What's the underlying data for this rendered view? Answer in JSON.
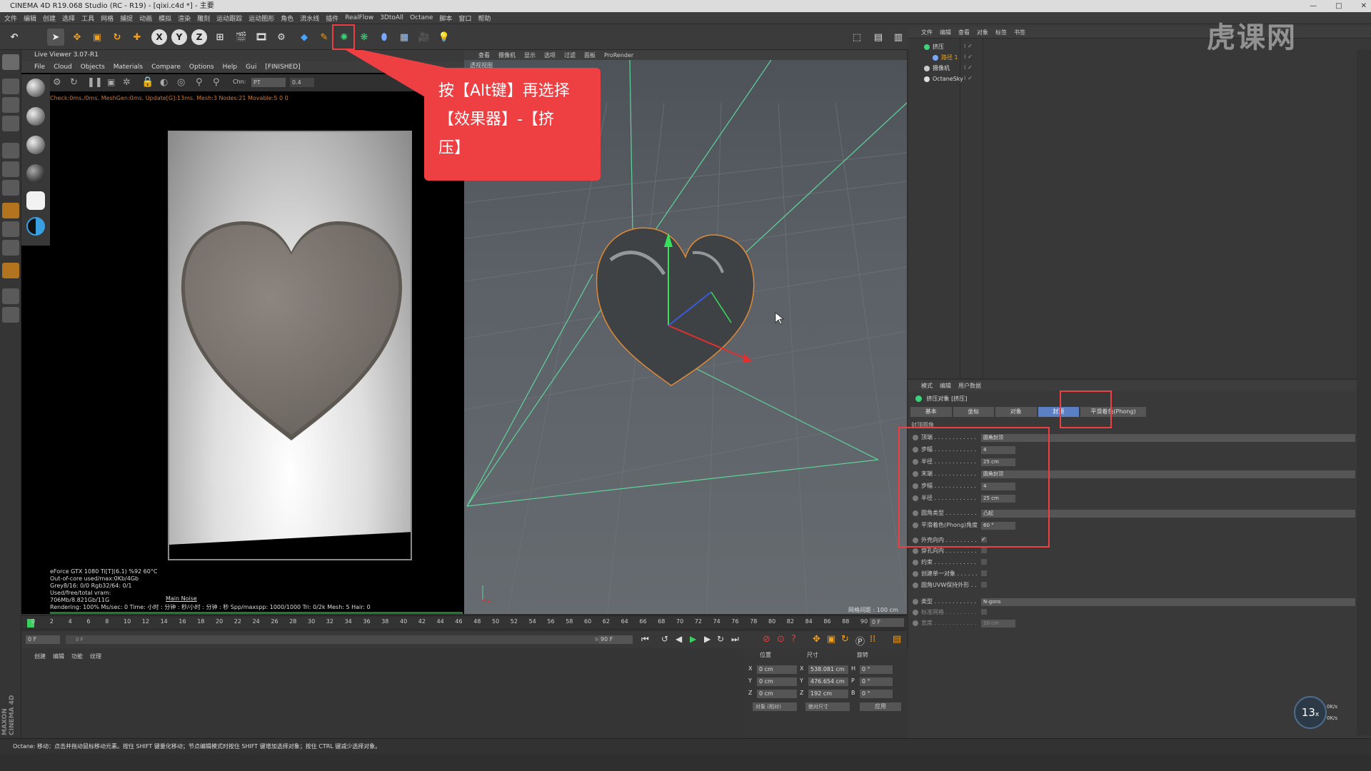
{
  "window": {
    "title": "CINEMA 4D R19.068 Studio (RC - R19) - [qixi.c4d *] - 主要",
    "controls": [
      "—",
      "□",
      "✕"
    ]
  },
  "menubar": [
    "文件",
    "编辑",
    "创建",
    "选择",
    "工具",
    "网格",
    "捕捉",
    "动画",
    "模拟",
    "渲染",
    "雕刻",
    "运动跟踪",
    "运动图形",
    "角色",
    "流水线",
    "插件",
    "RealFlow",
    "3DtoAll",
    "Octane",
    "脚本",
    "窗口",
    "帮助"
  ],
  "toolbar": {
    "axes": [
      "X",
      "Y",
      "Z"
    ],
    "undo_icon": "undo-icon"
  },
  "live_viewer": {
    "title": "Live Viewer 3.07-R1",
    "menu": [
      "File",
      "Cloud",
      "Objects",
      "Materials",
      "Compare",
      "Options",
      "Help",
      "Gui",
      "[FINISHED]"
    ],
    "chn_label": "Chn:",
    "chn_value": "PT",
    "zoom_value": "0.4",
    "status": "Check:0ms./0ms. MeshGen:0ms. Update[G]:13ms. Mesh:3 Nodes:21 Movable:5  0 0",
    "gpu_info": [
      "eForce GTX 1080 Ti[T](6.1)  %92     60°C",
      "Out-of-core used/max:0Kb/4Gb",
      "Grey8/16: 0/0          Rgb32/64: 0/1",
      "Used/free/total vram: 706Mb/8.821Gb/11G"
    ],
    "main_tab": "Main  Noise",
    "render_line": "Rendering: 100%   Ms/sec: 0   Time: 小时 : 分钟 : 秒/小时 : 分钟 : 秒   Spp/maxspp: 1000/1000  Tri: 0/2k    Mesh: 5    Hair: 0"
  },
  "viewport": {
    "menu": [
      "查看",
      "摄像机",
      "显示",
      "选项",
      "过滤",
      "面板",
      "ProRender"
    ],
    "camera_label": "透视视图",
    "grid_label": "网格间距 : 100 cm"
  },
  "callout": {
    "lines": [
      "按【Alt键】再选择",
      "【效果器】-【挤",
      "压】"
    ]
  },
  "object_manager": {
    "menu": [
      "文件",
      "编辑",
      "查看",
      "对象",
      "标签",
      "书签"
    ],
    "objects": [
      {
        "name": "挤压",
        "indent": 0
      },
      {
        "name": "路径 1",
        "indent": 1
      },
      {
        "name": "摄像机",
        "indent": 0
      },
      {
        "name": "OctaneSky",
        "indent": 0
      }
    ]
  },
  "attribute_manager": {
    "menu": [
      "模式",
      "编辑",
      "用户数据"
    ],
    "object_title": "挤压对象 [挤压]",
    "tabs": [
      "基本",
      "坐标",
      "对象",
      "封顶",
      "平滑着色(Phong)"
    ],
    "active_tab": "封顶",
    "section": "封顶圆角",
    "rows": [
      {
        "label": "顶端 . . . . . . . . . . . .",
        "value": "圆角封顶",
        "kind": "drop"
      },
      {
        "label": "步幅 . . . . . . . . . . . .",
        "value": "4",
        "kind": "num"
      },
      {
        "label": "半径 . . . . . . . . . . . .",
        "value": "25 cm",
        "kind": "num"
      },
      {
        "label": "末端 . . . . . . . . . . . .",
        "value": "圆角封顶",
        "kind": "drop"
      },
      {
        "label": "步幅 . . . . . . . . . . . .",
        "value": "4",
        "kind": "num"
      },
      {
        "label": "半径 . . . . . . . . . . . .",
        "value": "25 cm",
        "kind": "num"
      },
      {
        "label": "圆角类型 . . . . . . . . .",
        "value": "凸起",
        "kind": "drop"
      },
      {
        "label": "平滑着色(Phong)角度",
        "value": "60 °",
        "kind": "num"
      },
      {
        "label": "外壳向内 . . . . . . . . .",
        "value": "✓",
        "kind": "chk"
      },
      {
        "label": "穿孔向内 . . . . . . . . .",
        "value": "",
        "kind": "chk"
      },
      {
        "label": "约束 . . . . . . . . . . . .",
        "value": "",
        "kind": "chk"
      },
      {
        "label": "创建单一对象 . . . . . .",
        "value": "",
        "kind": "chk"
      },
      {
        "label": "圆角UVW保持外形 . .",
        "value": "",
        "kind": "chk"
      },
      {
        "label": "类型 . . . . . . . . . . . .",
        "value": "N-gons",
        "kind": "drop"
      },
      {
        "label": "标准网格 . . . . . . . . .",
        "value": "",
        "kind": "chk"
      },
      {
        "label": "宽度 . . . . . . . . . . . .",
        "value": "10 cm",
        "kind": "num"
      }
    ]
  },
  "timeline": {
    "ticks": [
      "0",
      "2",
      "4",
      "6",
      "8",
      "10",
      "12",
      "14",
      "16",
      "18",
      "20",
      "22",
      "24",
      "26",
      "28",
      "30",
      "32",
      "34",
      "36",
      "38",
      "40",
      "42",
      "44",
      "46",
      "48",
      "50",
      "52",
      "54",
      "56",
      "58",
      "60",
      "62",
      "64",
      "66",
      "68",
      "70",
      "72",
      "74",
      "76",
      "78",
      "80",
      "82",
      "84",
      "86",
      "88",
      "90"
    ],
    "current_frame": "0 F",
    "start_field": "0 F",
    "range_start": "0 F",
    "range_end": "90 F",
    "end_field": "90 F"
  },
  "material_manager": {
    "menu": [
      "创建",
      "编辑",
      "功能",
      "纹理"
    ]
  },
  "coordinates": {
    "headers": [
      "位置",
      "尺寸",
      "旋转"
    ],
    "rows": [
      {
        "axis": "X",
        "pos": "0 cm",
        "size": "538.081 cm",
        "rot_label": "H",
        "rot": "0 °"
      },
      {
        "axis": "Y",
        "pos": "0 cm",
        "size": "476.654 cm",
        "rot_label": "P",
        "rot": "0 °"
      },
      {
        "axis": "Z",
        "pos": "0 cm",
        "size": "192 cm",
        "rot_label": "B",
        "rot": "0 °"
      }
    ],
    "mode1": "对象 (相对)",
    "mode2": "绝对尺寸",
    "apply": "应用"
  },
  "statusbar": "Octane:     移动：点击并拖动鼠标移动元素。按住 SHIFT 键量化移动；节点编辑模式时按住 SHIFT 键增加选择对象；按住 CTRL 键减少选择对象。",
  "watermark": "虎课网",
  "fps_badge": {
    "value": "13",
    "unit": "x",
    "up": "0K/s",
    "down": "0K/s"
  },
  "brand": "MAXON CINEMA 4D",
  "colors": {
    "accent_red": "#ee3f43",
    "tab_blue": "#5a7fc2"
  }
}
